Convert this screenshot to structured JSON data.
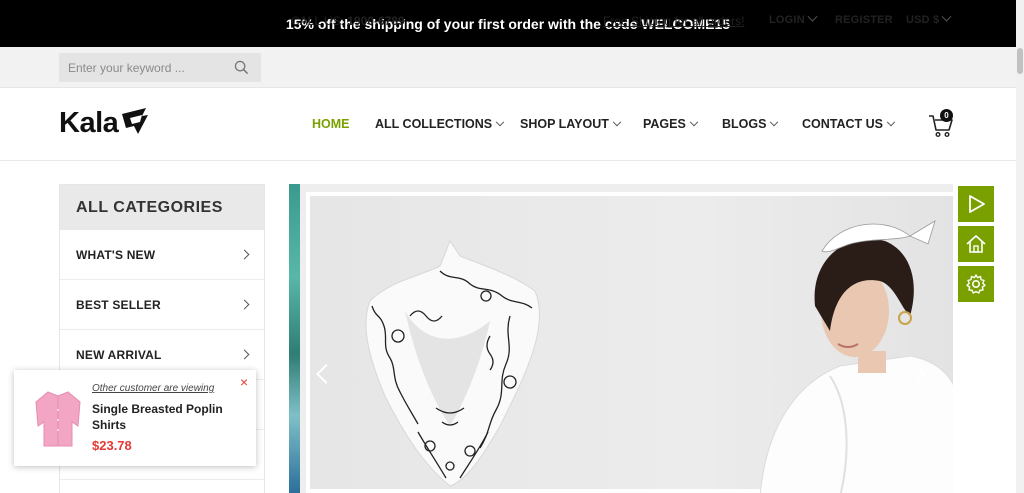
{
  "announcement": "15% off the shipping of your first order with the code WELCOME15",
  "topbar": {
    "search_placeholder": "Enter your keyword ...",
    "call_label": "CALL US:",
    "call_number": "1900-6789",
    "free_shipping": "Free Shiping for all orders!",
    "login": "LOGIN",
    "register": "REGISTER",
    "currency": "USD $"
  },
  "header": {
    "logo_text": "Kala",
    "nav": {
      "home": "HOME",
      "collections": "ALL COLLECTIONS",
      "shop_layout": "SHOP LAYOUT",
      "pages": "PAGES",
      "blogs": "BLOGS",
      "contact": "CONTACT US"
    },
    "cart_count": "0"
  },
  "categories": {
    "title": "ALL CATEGORIES",
    "items": [
      "WHAT'S NEW",
      "BEST SELLER",
      "NEW ARRIVAL"
    ]
  },
  "popup": {
    "viewing": "Other customer are viewing",
    "product_name": "Single Breasted Poplin Shirts",
    "price": "$23.78",
    "close": "×"
  },
  "colors": {
    "accent": "#7aa000",
    "price": "#e53935",
    "announce_bg": "#000000"
  },
  "icons": [
    "search-icon",
    "cart-icon",
    "play-icon",
    "home-icon",
    "gear-icon",
    "close-icon"
  ]
}
